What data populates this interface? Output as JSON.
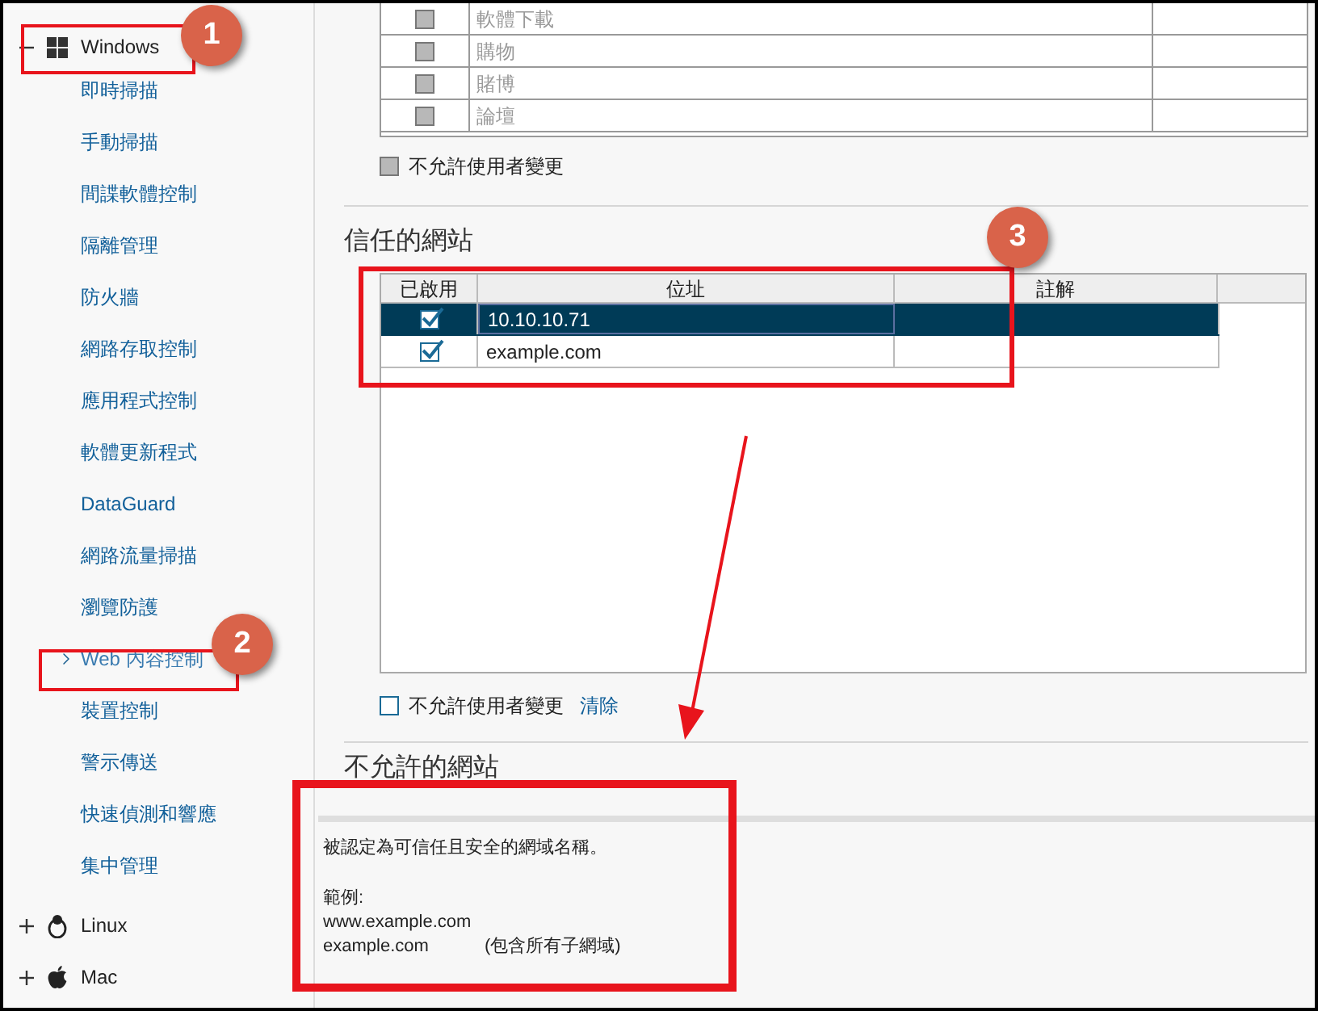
{
  "sidebar": {
    "platforms": [
      {
        "label": "Windows",
        "kind": "windows",
        "expanded": true,
        "children": [
          {
            "label": "即時掃描",
            "selected": false
          },
          {
            "label": "手動掃描",
            "selected": false
          },
          {
            "label": "間諜軟體控制",
            "selected": false
          },
          {
            "label": "隔離管理",
            "selected": false
          },
          {
            "label": "防火牆",
            "selected": false
          },
          {
            "label": "網路存取控制",
            "selected": false
          },
          {
            "label": "應用程式控制",
            "selected": false
          },
          {
            "label": "軟體更新程式",
            "selected": false
          },
          {
            "label": "DataGuard",
            "selected": false
          },
          {
            "label": "網路流量掃描",
            "selected": false
          },
          {
            "label": "瀏覽防護",
            "selected": false
          },
          {
            "label": "Web 內容控制",
            "selected": true
          },
          {
            "label": "裝置控制",
            "selected": false
          },
          {
            "label": "警示傳送",
            "selected": false
          },
          {
            "label": "快速偵測和響應",
            "selected": false
          },
          {
            "label": "集中管理",
            "selected": false
          }
        ]
      },
      {
        "label": "Linux",
        "kind": "linux",
        "expanded": false
      },
      {
        "label": "Mac",
        "kind": "mac",
        "expanded": false
      }
    ]
  },
  "category_table": {
    "rows": [
      {
        "name": "軟體下載",
        "checked": false,
        "disabled": true
      },
      {
        "name": "購物",
        "checked": false,
        "disabled": true
      },
      {
        "name": "賭博",
        "checked": false,
        "disabled": true
      },
      {
        "name": "論壇",
        "checked": false,
        "disabled": true
      }
    ],
    "lock": {
      "label": "不允許使用者變更",
      "checked": false,
      "disabled": true
    }
  },
  "trusted_sites": {
    "title": "信任的網站",
    "columns": [
      "已啟用",
      "位址",
      "註解"
    ],
    "rows": [
      {
        "enabled": true,
        "address": "10.10.10.71",
        "selected": true
      },
      {
        "enabled": true,
        "address": "example.com",
        "selected": false
      }
    ],
    "lock": {
      "label": "不允許使用者變更",
      "checked": false,
      "disabled": false
    },
    "clear_link": "清除"
  },
  "blocked_sites": {
    "title": "不允許的網站"
  },
  "tooltip": {
    "description": "被認定為可信任且安全的網域名稱。",
    "example_label": "範例:",
    "examples": [
      {
        "domain": "www.example.com"
      },
      {
        "domain": "example.com",
        "note": "(包含所有子網域)"
      }
    ]
  },
  "annotations": [
    "1",
    "2",
    "3"
  ]
}
